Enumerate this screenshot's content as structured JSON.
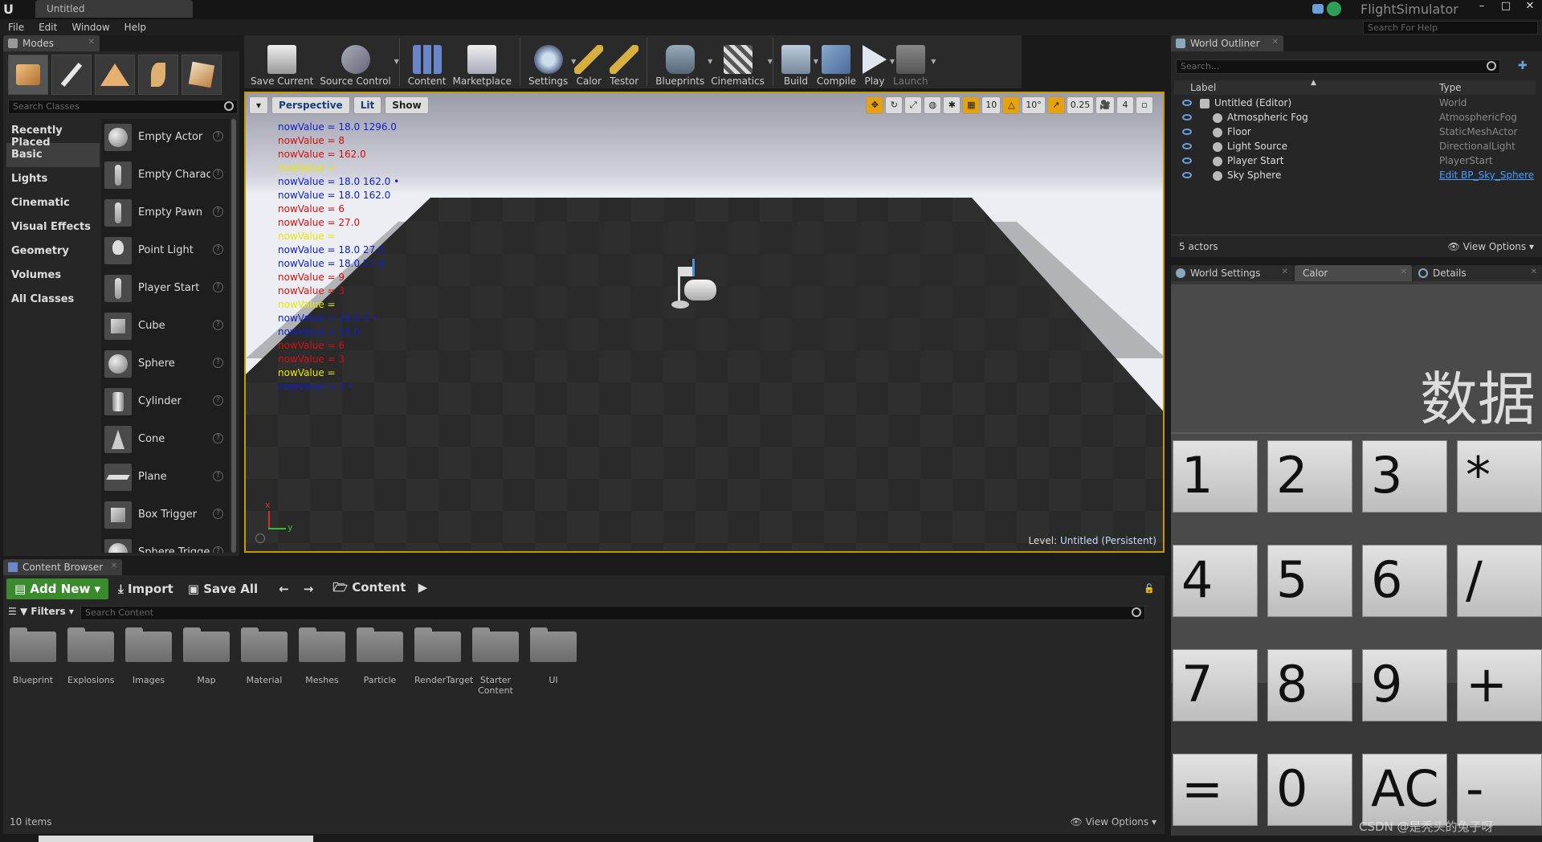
{
  "titlebar": {
    "tab": "Untitled",
    "app_name": "FlightSimulator",
    "minimize": "–",
    "maximize": "□",
    "close": "✕"
  },
  "menu": [
    "File",
    "Edit",
    "Window",
    "Help"
  ],
  "help_search": {
    "placeholder": "Search For Help"
  },
  "modes": {
    "tab": "Modes",
    "search_placeholder": "Search Classes",
    "categories": [
      "Recently Placed",
      "Basic",
      "Lights",
      "Cinematic",
      "Visual Effects",
      "Geometry",
      "Volumes",
      "All Classes"
    ],
    "selected_category": "Basic",
    "items": [
      "Empty Actor",
      "Empty Character",
      "Empty Pawn",
      "Point Light",
      "Player Start",
      "Cube",
      "Sphere",
      "Cylinder",
      "Cone",
      "Plane",
      "Box Trigger",
      "Sphere Trigger"
    ]
  },
  "toolbar": {
    "buttons": [
      "Save Current",
      "Source Control",
      "Content",
      "Marketplace",
      "Settings",
      "Calor",
      "Testor",
      "Blueprints",
      "Cinematics",
      "Build",
      "Compile",
      "Play",
      "Launch"
    ]
  },
  "viewport": {
    "perspective": "Perspective",
    "lit": "Lit",
    "show": "Show",
    "grid_snap": "10",
    "rot_snap": "10°",
    "scale_snap": "0.25",
    "cam_speed": "4",
    "level_label": "Level:",
    "level_name": "Untitled (Persistent)",
    "axis_x": "x",
    "axis_y": "y",
    "log": [
      {
        "text": "nowValue = 18.0 1296.0",
        "color": "blue"
      },
      {
        "text": "nowValue = 8",
        "color": "red"
      },
      {
        "text": "nowValue = 162.0",
        "color": "red"
      },
      {
        "text": "nowValue =",
        "color": "yellow"
      },
      {
        "text": "nowValue = 18.0 162.0 •",
        "color": "blue"
      },
      {
        "text": "nowValue = 18.0 162.0",
        "color": "blue"
      },
      {
        "text": "nowValue = 6",
        "color": "red"
      },
      {
        "text": "nowValue = 27.0",
        "color": "red"
      },
      {
        "text": "nowValue =",
        "color": "yellow"
      },
      {
        "text": "nowValue = 18.0 27.0",
        "color": "blue"
      },
      {
        "text": "nowValue = 18.0 27.0",
        "color": "blue"
      },
      {
        "text": "nowValue = 9",
        "color": "red"
      },
      {
        "text": "nowValue = 3",
        "color": "red"
      },
      {
        "text": "nowValue =",
        "color": "yellow"
      },
      {
        "text": "nowValue = 18.0 3 •",
        "color": "blue"
      },
      {
        "text": "nowValue = 18.0",
        "color": "blue"
      },
      {
        "text": "nowValue = 6",
        "color": "red"
      },
      {
        "text": "nowValue = 3",
        "color": "red"
      },
      {
        "text": "nowValue =",
        "color": "yellow"
      },
      {
        "text": "nowValue = 3 •",
        "color": "blue"
      }
    ]
  },
  "outliner": {
    "tab": "World Outliner",
    "search_placeholder": "Search...",
    "col_label": "Label",
    "col_type": "Type",
    "rows": [
      {
        "label": "Untitled (Editor)",
        "type": "World",
        "indent": 0
      },
      {
        "label": "Atmospheric Fog",
        "type": "AtmosphericFog",
        "indent": 1
      },
      {
        "label": "Floor",
        "type": "StaticMeshActor",
        "indent": 1
      },
      {
        "label": "Light Source",
        "type": "DirectionalLight",
        "indent": 1
      },
      {
        "label": "Player Start",
        "type": "PlayerStart",
        "indent": 1
      },
      {
        "label": "Sky Sphere",
        "type": "Edit BP_Sky_Sphere",
        "indent": 1,
        "link": true
      }
    ],
    "count": "5 actors",
    "view_options": "View Options"
  },
  "details_tabs": [
    "World Settings",
    "Calor",
    "Details"
  ],
  "calculator": {
    "title": "数据",
    "keys": [
      "1",
      "2",
      "3",
      "*",
      "4",
      "5",
      "6",
      "/",
      "7",
      "8",
      "9",
      "+",
      "=",
      "0",
      "AC",
      "-"
    ]
  },
  "content_browser": {
    "tab": "Content Browser",
    "add_new": "Add New",
    "import": "Import",
    "save_all": "Save All",
    "path": "Content",
    "filters": "Filters",
    "search_placeholder": "Search Content",
    "folders": [
      "Blueprint",
      "Explosions",
      "Images",
      "Map",
      "Material",
      "Meshes",
      "Particle",
      "RenderTarget",
      "Starter Content",
      "UI"
    ],
    "count": "10 items",
    "view_options": "View Options"
  },
  "watermark": "CSDN @是秃头的兔子呀",
  "colors": {
    "log_blue": "#1020c8",
    "log_red": "#d01010",
    "log_yellow": "#e8e800",
    "add_new_green": "#3b8a2e",
    "viewport_border": "#c59a00"
  }
}
